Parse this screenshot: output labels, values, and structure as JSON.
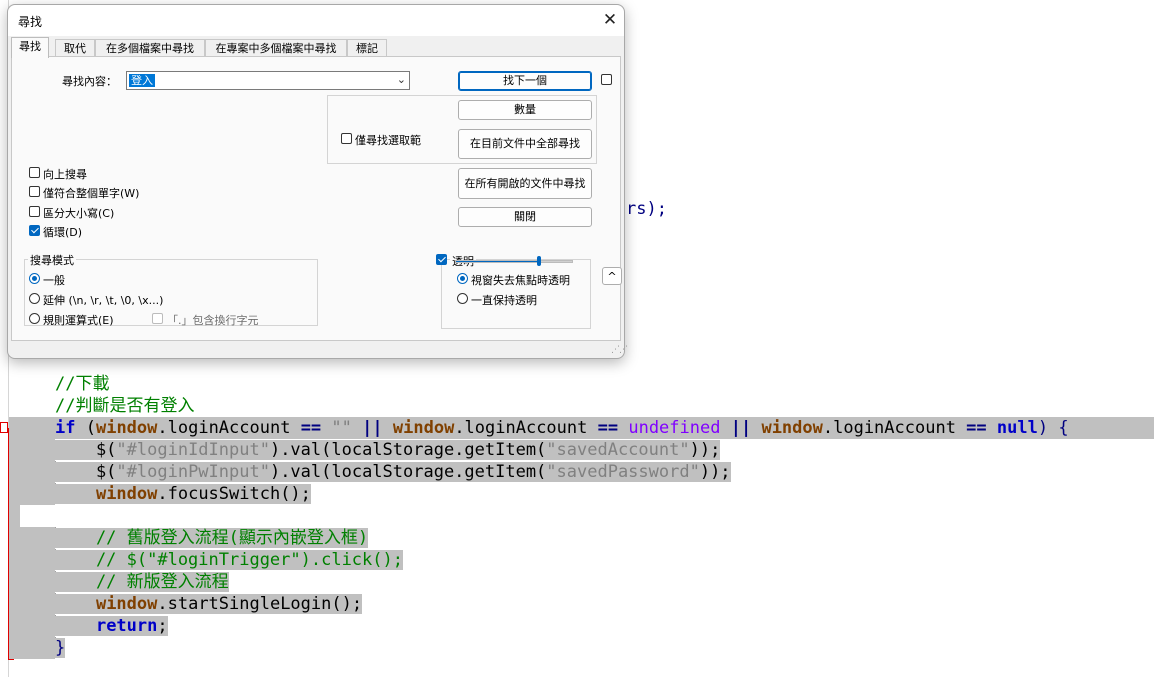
{
  "editor": {
    "partial_line": "rs);",
    "lines": [
      {
        "segments": [
          {
            "t": "//下載",
            "c": "cm"
          }
        ]
      },
      {
        "segments": [
          {
            "t": "//判斷是否有登入",
            "c": "cm"
          }
        ]
      },
      {
        "segments": [
          {
            "t": "if",
            "c": "kw"
          },
          {
            "t": " (",
            "c": "pl"
          },
          {
            "t": "window",
            "c": "wd"
          },
          {
            "t": ".loginAccount ",
            "c": "pl"
          },
          {
            "t": "==",
            "c": "op"
          },
          {
            "t": " ",
            "c": "pl"
          },
          {
            "t": "\"\"",
            "c": "st"
          },
          {
            "t": " ",
            "c": "pl"
          },
          {
            "t": "||",
            "c": "op"
          },
          {
            "t": " ",
            "c": "pl"
          },
          {
            "t": "window",
            "c": "wd"
          },
          {
            "t": ".loginAccount ",
            "c": "pl"
          },
          {
            "t": "==",
            "c": "op"
          },
          {
            "t": " ",
            "c": "pl"
          },
          {
            "t": "undefined",
            "c": "ud"
          },
          {
            "t": " ",
            "c": "pl"
          },
          {
            "t": "||",
            "c": "op"
          },
          {
            "t": " ",
            "c": "pl"
          },
          {
            "t": "window",
            "c": "wd"
          },
          {
            "t": ".loginAccount ",
            "c": "pl"
          },
          {
            "t": "==",
            "c": "op"
          },
          {
            "t": " ",
            "c": "pl"
          },
          {
            "t": "null",
            "c": "kw"
          },
          {
            "t": ") {",
            "c": "ds"
          }
        ]
      },
      {
        "segments": [
          {
            "t": "    $(",
            "c": "pl"
          },
          {
            "t": "\"#loginIdInput\"",
            "c": "st"
          },
          {
            "t": ").val(localStorage.getItem(",
            "c": "pl"
          },
          {
            "t": "\"savedAccount\"",
            "c": "st"
          },
          {
            "t": "));",
            "c": "pl"
          }
        ]
      },
      {
        "segments": [
          {
            "t": "    $(",
            "c": "pl"
          },
          {
            "t": "\"#loginPwInput\"",
            "c": "st"
          },
          {
            "t": ").val(localStorage.getItem(",
            "c": "pl"
          },
          {
            "t": "\"savedPassword\"",
            "c": "st"
          },
          {
            "t": "));",
            "c": "pl"
          }
        ]
      },
      {
        "segments": [
          {
            "t": "    ",
            "c": "pl"
          },
          {
            "t": "window",
            "c": "wd"
          },
          {
            "t": ".focusSwitch();",
            "c": "pl"
          }
        ]
      },
      {
        "segments": []
      },
      {
        "segments": [
          {
            "t": "    // 舊版登入流程(顯示內嵌登入框)",
            "c": "cm"
          }
        ]
      },
      {
        "segments": [
          {
            "t": "    // $(\"#loginTrigger\").click();",
            "c": "cm"
          }
        ]
      },
      {
        "segments": [
          {
            "t": "    // 新版登入流程",
            "c": "cm"
          }
        ]
      },
      {
        "segments": [
          {
            "t": "    ",
            "c": "pl"
          },
          {
            "t": "window",
            "c": "wd"
          },
          {
            "t": ".startSingleLogin();",
            "c": "pl"
          }
        ]
      },
      {
        "segments": [
          {
            "t": "    ",
            "c": "pl"
          },
          {
            "t": "return",
            "c": "kw"
          },
          {
            "t": ";",
            "c": "pl"
          }
        ]
      },
      {
        "segments": [
          {
            "t": "}",
            "c": "ds"
          }
        ]
      }
    ]
  },
  "dialog": {
    "title": "尋找",
    "close": "✕",
    "tabs": [
      "尋找",
      "取代",
      "在多個檔案中尋找",
      "在專案中多個檔案中尋找",
      "標記"
    ],
    "find_label": "尋找內容：",
    "find_value": "登入",
    "buttons": {
      "find_next": "找下一個",
      "count": "數量",
      "find_all_current": "在目前文件中全部尋找",
      "find_all_open": "在所有開啟的文件中尋找",
      "close": "關閉"
    },
    "in_selection": "僅尋找選取範",
    "options": [
      {
        "label": "向上搜尋",
        "checked": false
      },
      {
        "label": "僅符合整個單字(W)",
        "checked": false
      },
      {
        "label": "區分大小寫(C)",
        "checked": false
      },
      {
        "label": "循環(D)",
        "checked": true
      }
    ],
    "search_mode": {
      "title": "搜尋模式",
      "normal": "一般",
      "extended": "延伸 (\\n, \\r, \\t, \\0, \\x...)",
      "regex": "規則運算式(E)",
      "dot_newline": "「.」包含換行字元",
      "selected": "normal"
    },
    "transparency": {
      "label": "透明",
      "checked": true,
      "on_lose_focus": "視窗失去焦點時透明",
      "always": "一直保持透明",
      "selected": "on_lose_focus",
      "level": 0.73
    },
    "collapse": "^"
  }
}
